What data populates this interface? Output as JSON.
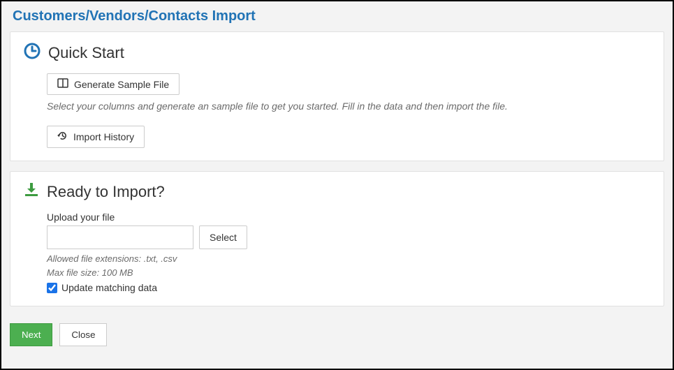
{
  "page": {
    "title": "Customers/Vendors/Contacts Import"
  },
  "quickStart": {
    "heading": "Quick Start",
    "generateButton": "Generate Sample File",
    "hint": "Select your columns and generate an sample file to get you started. Fill in the data and then import the file.",
    "historyButton": "Import History"
  },
  "readyToImport": {
    "heading": "Ready to Import?",
    "uploadLabel": "Upload your file",
    "selectButton": "Select",
    "allowedExt": "Allowed file extensions: .txt, .csv",
    "maxSize": "Max file size: 100 MB",
    "updateMatchingLabel": "Update matching data"
  },
  "footer": {
    "next": "Next",
    "close": "Close"
  }
}
